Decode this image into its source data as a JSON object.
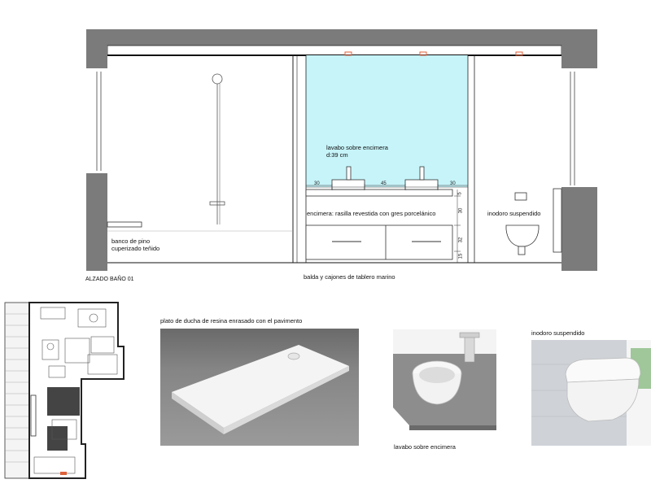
{
  "elevation": {
    "title": "ALZADO BAÑO 01",
    "labels": {
      "bench": "banco de pino cuperizado teñido",
      "basin_counter": "lavabo sobre encimera d:39 cm",
      "countertop": "encimera: rasilla revestida con gres porcelánico",
      "toilet": "inodoro suspendido",
      "shelf": "balda y cajones de tablero marino"
    },
    "dims_horizontal": [
      "30",
      "45",
      "30"
    ],
    "dims_vertical": [
      "5",
      "30",
      "32",
      "15"
    ],
    "colors": {
      "wall": "#7b7b7b",
      "glass": "#c6f4f9",
      "accent": "#e0613a"
    }
  },
  "photos": {
    "shower": {
      "caption": "plato de ducha de resina enrasado con el pavimento"
    },
    "basin": {
      "caption": "lavabo sobre encimera"
    },
    "toilet": {
      "caption": "inodoro suspendido"
    }
  }
}
